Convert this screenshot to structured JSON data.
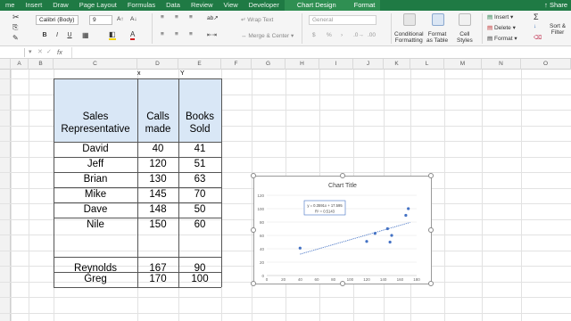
{
  "ribbon": {
    "tabs": [
      "me",
      "Insert",
      "Draw",
      "Page Layout",
      "Formulas",
      "Data",
      "Review",
      "View",
      "Developer",
      "Chart Design",
      "Format"
    ],
    "share": "Share",
    "font_name": "Calibri (Body)",
    "font_size": "9",
    "bold": "B",
    "italic": "I",
    "underline": "U",
    "wrap_text": "Wrap Text",
    "merge_center": "Merge & Center",
    "number_format": "General",
    "currency": "$",
    "percent": "%",
    "comma": "›",
    "conditional_formatting": [
      "Conditional",
      "Formatting"
    ],
    "format_as_table": [
      "Format",
      "as Table"
    ],
    "cell_styles": [
      "Cell",
      "Styles"
    ],
    "insert": "Insert",
    "delete": "Delete",
    "format": "Format",
    "sort_filter": [
      "Sort &",
      "Filter"
    ]
  },
  "formula_bar": {
    "fx": "fx",
    "name_box": ""
  },
  "columns": [
    "A",
    "B",
    "C",
    "D",
    "E",
    "F",
    "G",
    "H",
    "I",
    "J",
    "K",
    "L",
    "M",
    "N",
    "O"
  ],
  "table": {
    "axis_markers": [
      "x",
      "Y"
    ],
    "headers": {
      "rep": [
        "Sales",
        "Representative"
      ],
      "calls": [
        "Calls",
        "made"
      ],
      "books": [
        "Books",
        "Sold"
      ]
    },
    "rows": [
      {
        "rep": "David",
        "calls": "40",
        "books": "41"
      },
      {
        "rep": "Jeff",
        "calls": "120",
        "books": "51"
      },
      {
        "rep": "Brian",
        "calls": "130",
        "books": "63"
      },
      {
        "rep": "Mike",
        "calls": "145",
        "books": "70"
      },
      {
        "rep": "Dave",
        "calls": "148",
        "books": "50"
      },
      {
        "rep": "Nile",
        "calls": "150",
        "books": "60"
      },
      {
        "rep": "",
        "calls": "",
        "books": ""
      },
      {
        "rep": "Reynolds",
        "calls": "167",
        "books": "90"
      },
      {
        "rep": "Greg",
        "calls": "170",
        "books": "100"
      }
    ]
  },
  "chart_data": {
    "type": "scatter",
    "title": "Chart Title",
    "xlabel": "",
    "ylabel": "",
    "xlim": [
      0,
      180
    ],
    "ylim": [
      0,
      120
    ],
    "x_ticks": [
      0,
      20,
      40,
      60,
      80,
      100,
      120,
      140,
      160,
      180
    ],
    "y_ticks": [
      0,
      20,
      40,
      60,
      80,
      100,
      120
    ],
    "grid": true,
    "series": [
      {
        "x": [
          40,
          120,
          130,
          145,
          148,
          150,
          167,
          170
        ],
        "y": [
          41,
          51,
          63,
          70,
          50,
          60,
          90,
          100
        ],
        "color": "#4472c4"
      }
    ],
    "trendline": {
      "type": "linear",
      "slope": 0.3591,
      "intercept": 17.595,
      "equation": "y = 0.3591x + 17.595",
      "r_squared": "R² = 0.5143",
      "color": "#4472c4",
      "style": "dotted"
    }
  }
}
